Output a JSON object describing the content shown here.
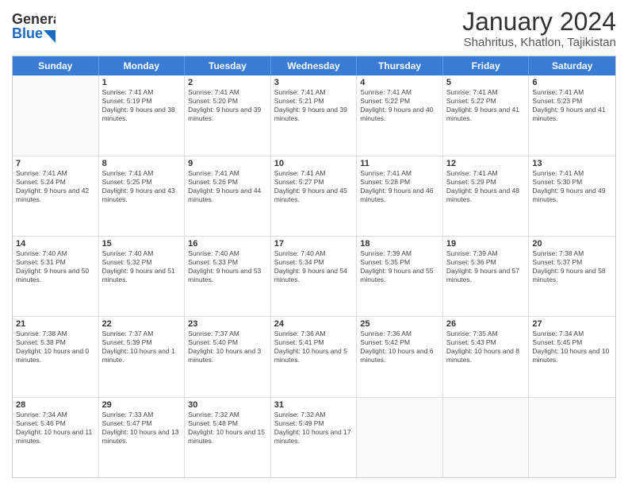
{
  "header": {
    "logo_line1": "General",
    "logo_line2": "Blue",
    "title": "January 2024",
    "subtitle": "Shahritus, Khatlon, Tajikistan"
  },
  "days_of_week": [
    "Sunday",
    "Monday",
    "Tuesday",
    "Wednesday",
    "Thursday",
    "Friday",
    "Saturday"
  ],
  "weeks": [
    [
      {
        "day": "",
        "sunrise": "",
        "sunset": "",
        "daylight": "",
        "empty": true
      },
      {
        "day": "1",
        "sunrise": "Sunrise: 7:41 AM",
        "sunset": "Sunset: 5:19 PM",
        "daylight": "Daylight: 9 hours and 38 minutes.",
        "empty": false
      },
      {
        "day": "2",
        "sunrise": "Sunrise: 7:41 AM",
        "sunset": "Sunset: 5:20 PM",
        "daylight": "Daylight: 9 hours and 39 minutes.",
        "empty": false
      },
      {
        "day": "3",
        "sunrise": "Sunrise: 7:41 AM",
        "sunset": "Sunset: 5:21 PM",
        "daylight": "Daylight: 9 hours and 39 minutes.",
        "empty": false
      },
      {
        "day": "4",
        "sunrise": "Sunrise: 7:41 AM",
        "sunset": "Sunset: 5:22 PM",
        "daylight": "Daylight: 9 hours and 40 minutes.",
        "empty": false
      },
      {
        "day": "5",
        "sunrise": "Sunrise: 7:41 AM",
        "sunset": "Sunset: 5:22 PM",
        "daylight": "Daylight: 9 hours and 41 minutes.",
        "empty": false
      },
      {
        "day": "6",
        "sunrise": "Sunrise: 7:41 AM",
        "sunset": "Sunset: 5:23 PM",
        "daylight": "Daylight: 9 hours and 41 minutes.",
        "empty": false
      }
    ],
    [
      {
        "day": "7",
        "sunrise": "Sunrise: 7:41 AM",
        "sunset": "Sunset: 5:24 PM",
        "daylight": "Daylight: 9 hours and 42 minutes.",
        "empty": false
      },
      {
        "day": "8",
        "sunrise": "Sunrise: 7:41 AM",
        "sunset": "Sunset: 5:25 PM",
        "daylight": "Daylight: 9 hours and 43 minutes.",
        "empty": false
      },
      {
        "day": "9",
        "sunrise": "Sunrise: 7:41 AM",
        "sunset": "Sunset: 5:26 PM",
        "daylight": "Daylight: 9 hours and 44 minutes.",
        "empty": false
      },
      {
        "day": "10",
        "sunrise": "Sunrise: 7:41 AM",
        "sunset": "Sunset: 5:27 PM",
        "daylight": "Daylight: 9 hours and 45 minutes.",
        "empty": false
      },
      {
        "day": "11",
        "sunrise": "Sunrise: 7:41 AM",
        "sunset": "Sunset: 5:28 PM",
        "daylight": "Daylight: 9 hours and 46 minutes.",
        "empty": false
      },
      {
        "day": "12",
        "sunrise": "Sunrise: 7:41 AM",
        "sunset": "Sunset: 5:29 PM",
        "daylight": "Daylight: 9 hours and 48 minutes.",
        "empty": false
      },
      {
        "day": "13",
        "sunrise": "Sunrise: 7:41 AM",
        "sunset": "Sunset: 5:30 PM",
        "daylight": "Daylight: 9 hours and 49 minutes.",
        "empty": false
      }
    ],
    [
      {
        "day": "14",
        "sunrise": "Sunrise: 7:40 AM",
        "sunset": "Sunset: 5:31 PM",
        "daylight": "Daylight: 9 hours and 50 minutes.",
        "empty": false
      },
      {
        "day": "15",
        "sunrise": "Sunrise: 7:40 AM",
        "sunset": "Sunset: 5:32 PM",
        "daylight": "Daylight: 9 hours and 51 minutes.",
        "empty": false
      },
      {
        "day": "16",
        "sunrise": "Sunrise: 7:40 AM",
        "sunset": "Sunset: 5:33 PM",
        "daylight": "Daylight: 9 hours and 53 minutes.",
        "empty": false
      },
      {
        "day": "17",
        "sunrise": "Sunrise: 7:40 AM",
        "sunset": "Sunset: 5:34 PM",
        "daylight": "Daylight: 9 hours and 54 minutes.",
        "empty": false
      },
      {
        "day": "18",
        "sunrise": "Sunrise: 7:39 AM",
        "sunset": "Sunset: 5:35 PM",
        "daylight": "Daylight: 9 hours and 55 minutes.",
        "empty": false
      },
      {
        "day": "19",
        "sunrise": "Sunrise: 7:39 AM",
        "sunset": "Sunset: 5:36 PM",
        "daylight": "Daylight: 9 hours and 57 minutes.",
        "empty": false
      },
      {
        "day": "20",
        "sunrise": "Sunrise: 7:38 AM",
        "sunset": "Sunset: 5:37 PM",
        "daylight": "Daylight: 9 hours and 58 minutes.",
        "empty": false
      }
    ],
    [
      {
        "day": "21",
        "sunrise": "Sunrise: 7:38 AM",
        "sunset": "Sunset: 5:38 PM",
        "daylight": "Daylight: 10 hours and 0 minutes.",
        "empty": false
      },
      {
        "day": "22",
        "sunrise": "Sunrise: 7:37 AM",
        "sunset": "Sunset: 5:39 PM",
        "daylight": "Daylight: 10 hours and 1 minute.",
        "empty": false
      },
      {
        "day": "23",
        "sunrise": "Sunrise: 7:37 AM",
        "sunset": "Sunset: 5:40 PM",
        "daylight": "Daylight: 10 hours and 3 minutes.",
        "empty": false
      },
      {
        "day": "24",
        "sunrise": "Sunrise: 7:36 AM",
        "sunset": "Sunset: 5:41 PM",
        "daylight": "Daylight: 10 hours and 5 minutes.",
        "empty": false
      },
      {
        "day": "25",
        "sunrise": "Sunrise: 7:36 AM",
        "sunset": "Sunset: 5:42 PM",
        "daylight": "Daylight: 10 hours and 6 minutes.",
        "empty": false
      },
      {
        "day": "26",
        "sunrise": "Sunrise: 7:35 AM",
        "sunset": "Sunset: 5:43 PM",
        "daylight": "Daylight: 10 hours and 8 minutes.",
        "empty": false
      },
      {
        "day": "27",
        "sunrise": "Sunrise: 7:34 AM",
        "sunset": "Sunset: 5:45 PM",
        "daylight": "Daylight: 10 hours and 10 minutes.",
        "empty": false
      }
    ],
    [
      {
        "day": "28",
        "sunrise": "Sunrise: 7:34 AM",
        "sunset": "Sunset: 5:46 PM",
        "daylight": "Daylight: 10 hours and 11 minutes.",
        "empty": false
      },
      {
        "day": "29",
        "sunrise": "Sunrise: 7:33 AM",
        "sunset": "Sunset: 5:47 PM",
        "daylight": "Daylight: 10 hours and 13 minutes.",
        "empty": false
      },
      {
        "day": "30",
        "sunrise": "Sunrise: 7:32 AM",
        "sunset": "Sunset: 5:48 PM",
        "daylight": "Daylight: 10 hours and 15 minutes.",
        "empty": false
      },
      {
        "day": "31",
        "sunrise": "Sunrise: 7:32 AM",
        "sunset": "Sunset: 5:49 PM",
        "daylight": "Daylight: 10 hours and 17 minutes.",
        "empty": false
      },
      {
        "day": "",
        "sunrise": "",
        "sunset": "",
        "daylight": "",
        "empty": true
      },
      {
        "day": "",
        "sunrise": "",
        "sunset": "",
        "daylight": "",
        "empty": true
      },
      {
        "day": "",
        "sunrise": "",
        "sunset": "",
        "daylight": "",
        "empty": true
      }
    ]
  ]
}
